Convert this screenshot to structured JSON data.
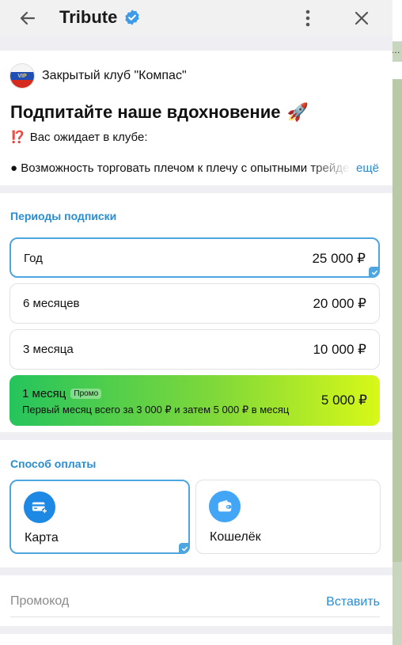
{
  "header": {
    "title": "Tribute",
    "back_icon": "arrow-left-icon",
    "verified_icon": "verified-badge-icon",
    "menu_icon": "more-vertical-icon",
    "close_icon": "close-icon"
  },
  "club": {
    "name": "Закрытый клуб \"Компас\"",
    "avatar_text": "VIP"
  },
  "intro": {
    "headline": "Подпитайте наше вдохновение",
    "headline_emoji": "🚀",
    "line1_emoji": "⁉️",
    "line1": "Вас ожидает в клубе:",
    "bullet": "● Возможность торговать плечом к плечу с опытными трейдерами",
    "more": "ещё"
  },
  "periods": {
    "title": "Периоды подписки",
    "items": [
      {
        "name": "Год",
        "price": "25 000 ₽",
        "selected": true
      },
      {
        "name": "6 месяцев",
        "price": "20 000 ₽",
        "selected": false
      },
      {
        "name": "3 месяца",
        "price": "10 000 ₽",
        "selected": false
      }
    ],
    "promo_item": {
      "name": "1 месяц",
      "badge": "Промо",
      "subtitle": "Первый месяц всего за 3 000 ₽ и затем 5 000 ₽ в месяц",
      "price": "5 000 ₽"
    }
  },
  "payment": {
    "title": "Способ оплаты",
    "methods": [
      {
        "label": "Карта",
        "icon": "credit-card-icon",
        "selected": true
      },
      {
        "label": "Кошелёк",
        "icon": "wallet-icon",
        "selected": false
      }
    ]
  },
  "promocode": {
    "placeholder": "Промокод",
    "paste_label": "Вставить"
  },
  "colors": {
    "accent": "#2a8dd2",
    "selected_border": "#4da6e0",
    "promo_gradient_start": "#25c45d",
    "promo_gradient_end": "#d8f818"
  }
}
